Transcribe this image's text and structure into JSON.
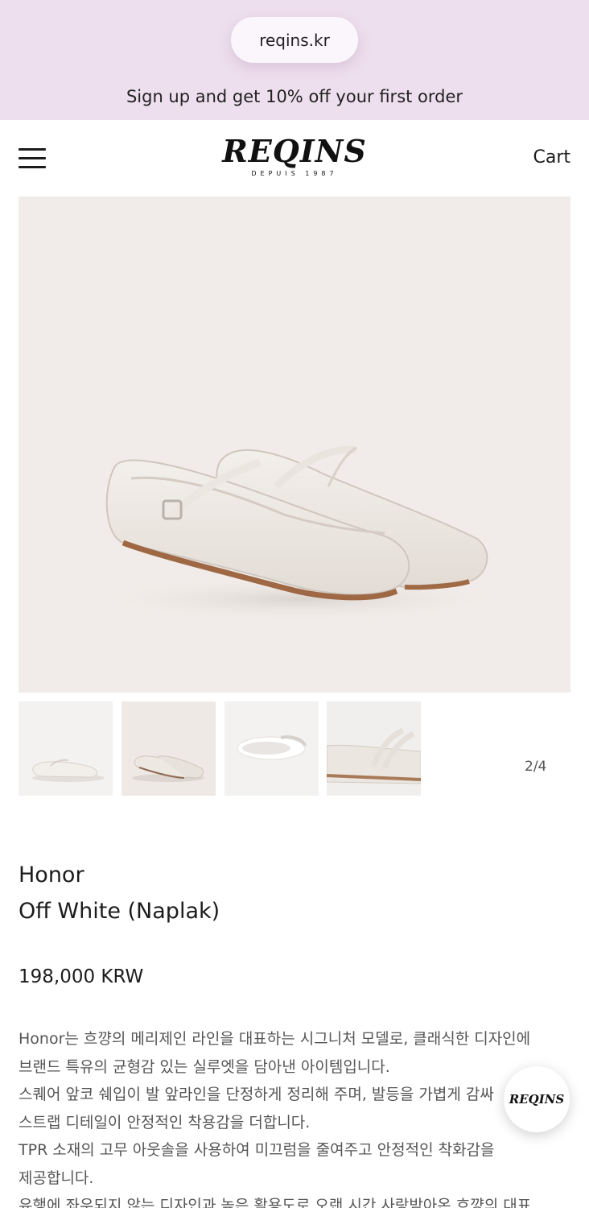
{
  "promo": {
    "url": "reqins.kr",
    "message": "Sign up and get 10% off your first order"
  },
  "header": {
    "logo_text": "REQINS",
    "logo_tagline": "DEPUIS 1987",
    "cart_label": "Cart",
    "menu_icon": "hamburger-menu-icon"
  },
  "gallery": {
    "counter": "2/4",
    "thumbnail_count": 4,
    "current_index": 2
  },
  "product": {
    "name_line1": "Honor",
    "name_line2": "Off White (Naplak)",
    "price": "198,000 KRW",
    "description": [
      "Honor는 흐꺙의 메리제인 라인을 대표하는 시그니처 모델로, 클래식한 디자인에",
      "브랜드 특유의 균형감 있는 실루엣을 담아낸 아이템입니다.",
      "스퀘어 앞코 쉐입이 발 앞라인을 단정하게 정리해 주며, 발등을 가볍게 감싸",
      "스트랩 디테일이 안정적인 착용감을 더합니다.",
      "TPR 소재의 고무 아웃솔을 사용하여 미끄럼을 줄여주고 안정적인 착화감을",
      "제공합니다.",
      "유행에 좌우되지 않는 디자인과 높은 활용도로 오랜 시간 사랑받아온 흐꺙의 대표"
    ]
  },
  "floating_badge": {
    "text": "REQINS"
  },
  "colors": {
    "promo_bg": "#eedfee",
    "image_bg": "#f1ece9",
    "text": "#1c1c1c",
    "muted_text": "#555555"
  }
}
